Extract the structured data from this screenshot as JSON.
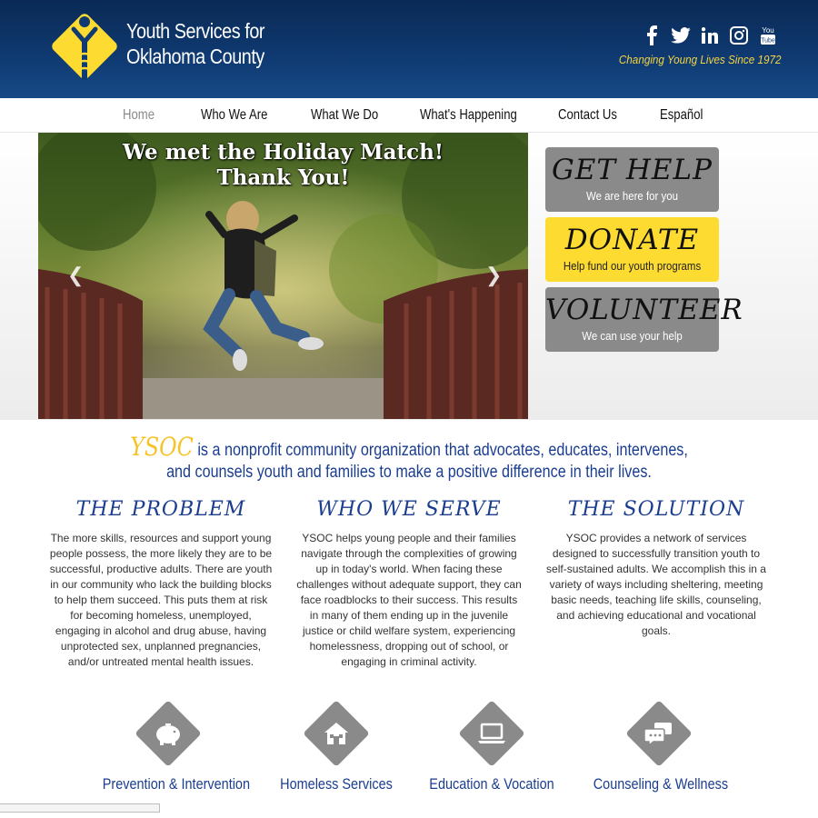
{
  "header": {
    "org_name_line1": "Youth Services for",
    "org_name_line2": "Oklahoma County",
    "tagline": "Changing Young Lives Since 1972",
    "social": [
      {
        "icon": "facebook-icon",
        "glyph": "f"
      },
      {
        "icon": "twitter-icon",
        "glyph": "t"
      },
      {
        "icon": "linkedin-icon",
        "glyph": "in"
      },
      {
        "icon": "instagram-icon",
        "glyph": "ig"
      },
      {
        "icon": "youtube-icon",
        "glyph": "You Tube"
      }
    ],
    "colors": {
      "header_bg": "#0f3a72",
      "tagline": "#f5d440",
      "logo_yellow": "#fddb30"
    }
  },
  "nav": {
    "items": [
      "Home",
      "Who We Are",
      "What We Do",
      "What's Happening",
      "Contact Us",
      "Español"
    ],
    "active": "Home"
  },
  "slider": {
    "title_line1": "We met the Holiday Match!",
    "title_line2": "Thank You!",
    "prev_glyph": "❮",
    "next_glyph": "❯"
  },
  "cta": {
    "get_help": {
      "title": "Get Help",
      "subtitle": "We are here for you"
    },
    "donate": {
      "title": "Donate",
      "subtitle": "Help fund our youth programs"
    },
    "volunteer": {
      "title": "Volunteer",
      "subtitle": "We can use your help"
    }
  },
  "mission": {
    "brand": "YSOC",
    "line1": "is a nonprofit community organization that advocates, educates, intervenes,",
    "line2": "and counsels youth and families to make a positive difference in their lives."
  },
  "columns": [
    {
      "title": "The Problem",
      "body": "The more skills, resources and support young people possess, the more likely they are to be successful, productive adults. There are youth in our community who lack the building blocks to help them succeed. This puts them at risk for becoming homeless, unemployed, engaging in alcohol and drug abuse, having unprotected sex, unplanned pregnancies, and/or untreated mental health issues."
    },
    {
      "title": "Who We Serve",
      "body": "YSOC helps young people and their families navigate through the complexities of growing up in today's world. When facing these challenges without adequate support, they can face roadblocks to their success. This results in many of them ending up in the juvenile justice or child welfare system, experiencing homelessness, dropping out of school, or engaging in criminal activity."
    },
    {
      "title": "The Solution",
      "body": "YSOC provides a network of services designed to successfully transition youth to self-sustained adults. We accomplish this in a variety of ways including sheltering, meeting basic needs, teaching life skills, counseling, and achieving educational and vocational goals."
    }
  ],
  "services": [
    {
      "label": "Prevention & Intervention",
      "icon": "piggy-bank-icon"
    },
    {
      "label": "Homeless Services",
      "icon": "house-icon"
    },
    {
      "label": "Education & Vocation",
      "icon": "laptop-icon"
    },
    {
      "label": "Counseling & Wellness",
      "icon": "chat-bubbles-icon"
    }
  ]
}
